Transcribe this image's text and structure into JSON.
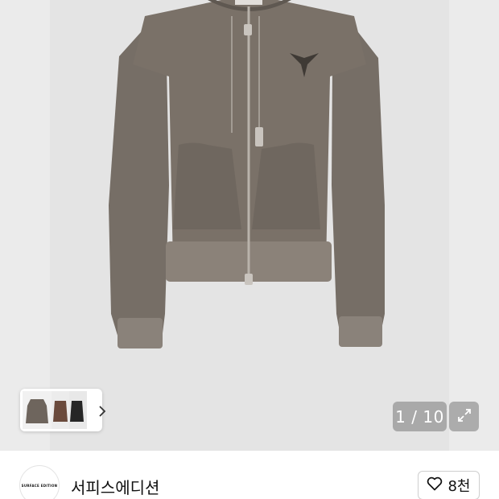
{
  "gallery": {
    "current_page": "1",
    "total_pages": "10",
    "counter_label": "1 / 10",
    "image_subject": "hoodie-zip-up",
    "thumbnail_nav_icon": "chevron-right-icon",
    "expand_icon": "expand-icon"
  },
  "brand": {
    "name": "서피스에디션",
    "logo_text": "SURFACE EDITION"
  },
  "like": {
    "icon": "heart-outline-icon",
    "count": "8천"
  },
  "colors": {
    "background": "#ebebeb",
    "garment": "#7a7168",
    "overlay_button": "#8a8a8a"
  }
}
